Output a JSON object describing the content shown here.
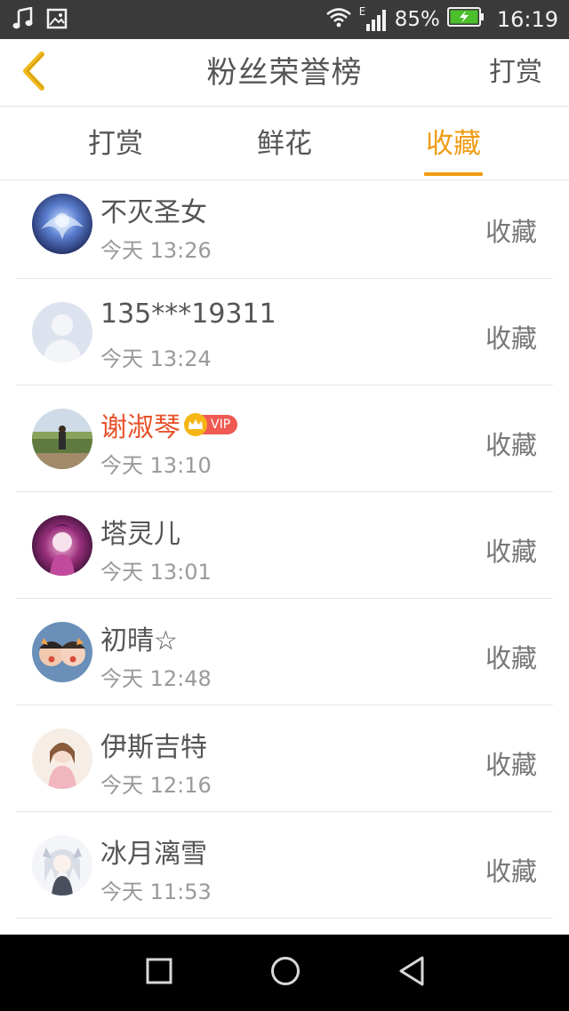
{
  "status_bar": {
    "signal_type": "E",
    "battery_percent": "85%",
    "time": "16:19",
    "icons": [
      "music-note-icon",
      "image-icon",
      "wifi-icon",
      "cell-signal-icon",
      "battery-charging-icon"
    ]
  },
  "header": {
    "title": "粉丝荣誉榜",
    "action_label": "打赏",
    "back_icon": "chevron-left-icon"
  },
  "tabs": [
    {
      "label": "打赏",
      "active": false
    },
    {
      "label": "鲜花",
      "active": false
    },
    {
      "label": "收藏",
      "active": true
    }
  ],
  "list": [
    {
      "name": "不灭圣女",
      "time": "今天 13:26",
      "action": "收藏",
      "vip": false
    },
    {
      "name": "135***19311",
      "time": "今天 13:24",
      "action": "收藏",
      "vip": false
    },
    {
      "name": "谢淑琴",
      "time": "今天 13:10",
      "action": "收藏",
      "vip": true,
      "vip_label": "VIP"
    },
    {
      "name": "塔灵儿",
      "time": "今天 13:01",
      "action": "收藏",
      "vip": false
    },
    {
      "name": "初晴☆",
      "time": "今天 12:48",
      "action": "收藏",
      "vip": false
    },
    {
      "name": "伊斯吉特",
      "time": "今天 12:16",
      "action": "收藏",
      "vip": false
    },
    {
      "name": "冰月漓雪",
      "time": "今天 11:53",
      "action": "收藏",
      "vip": false
    }
  ],
  "colors": {
    "accent": "#f09c14",
    "vip_name": "#e8522b",
    "text": "#555555",
    "subtext": "#9a9a9a",
    "status_bar_bg": "#3a3a3a",
    "nav_bar_bg": "#000000"
  },
  "nav_bar": {
    "icons": [
      "square-recents-icon",
      "circle-home-icon",
      "triangle-back-icon"
    ]
  }
}
